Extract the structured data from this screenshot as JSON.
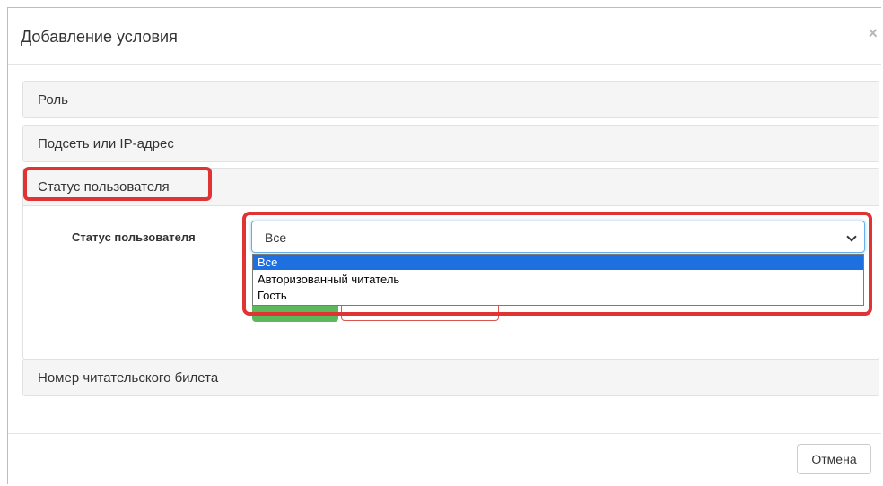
{
  "dialog": {
    "title": "Добавление условия",
    "close_glyph": "×"
  },
  "accordion": {
    "items": [
      {
        "label": "Роль",
        "expanded": false
      },
      {
        "label": "Подсеть или IP-адрес",
        "expanded": false
      },
      {
        "label": "Статус пользователя",
        "expanded": true
      },
      {
        "label": "Номер читательского билета",
        "expanded": false
      }
    ]
  },
  "status_form": {
    "field_label": "Статус пользователя",
    "selected_value": "Все",
    "options": [
      "Все",
      "Авторизованный читатель",
      "Гость"
    ],
    "selected_index": 0
  },
  "footer": {
    "cancel_label": "Отмена"
  },
  "colors": {
    "highlight": "#e03434",
    "selected_option": "#1e6fe0",
    "add_button": "#5cb85c",
    "danger_outline": "#d9534f"
  },
  "icons": {
    "close": "close-icon",
    "select_arrow": "chevron-down-icon"
  }
}
